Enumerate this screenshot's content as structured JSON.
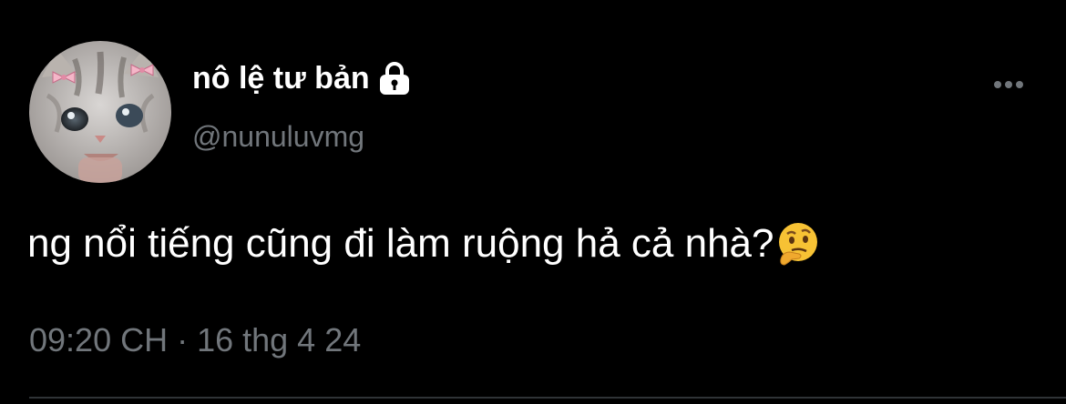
{
  "tweet": {
    "author": {
      "display_name": "nô lệ tư bản",
      "handle": "@nunuluvmg",
      "protected_icon": "lock-icon",
      "avatar": "cat-avatar"
    },
    "text": "ng nổi tiếng cũng đi làm ruộng hả cả nhà?",
    "emoji": "thinking-face-icon",
    "timestamp": "09:20 CH · 16 thg 4 24",
    "menu_icon": "more-horizontal-icon"
  },
  "colors": {
    "background": "#000000",
    "primary_text": "#ffffff",
    "secondary_text": "#71767b",
    "divider": "#2f3336"
  }
}
